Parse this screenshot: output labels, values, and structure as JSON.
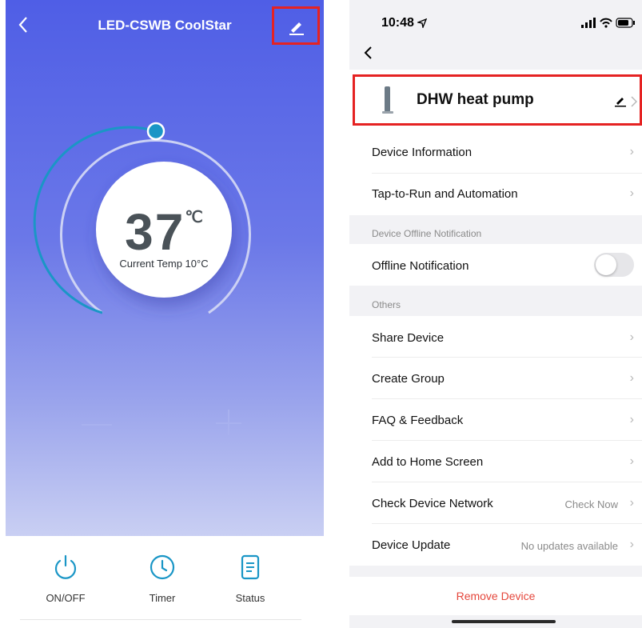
{
  "left_app": {
    "title": "LED-CSWB CoolStar",
    "set_temp": "37",
    "unit": "℃",
    "current_temp": "Current Temp 10°C",
    "toolbar": [
      {
        "label": "ON/OFF",
        "icon": "power-icon"
      },
      {
        "label": "Timer",
        "icon": "clock-icon"
      },
      {
        "label": "Status",
        "icon": "document-icon"
      }
    ],
    "accent_color": "#1a96c6",
    "highlight_color": "#e52222"
  },
  "right_app": {
    "status_time": "10:48",
    "device_name": "DHW heat pump",
    "rows": {
      "device_info": "Device Information",
      "tap_to_run": "Tap-to-Run and Automation",
      "offline_section": "Device Offline Notification",
      "offline_notification": "Offline Notification",
      "offline_notification_enabled": false,
      "others_section": "Others",
      "share_device": "Share Device",
      "create_group": "Create Group",
      "faq": "FAQ & Feedback",
      "add_home": "Add to Home Screen",
      "check_network": "Check Device Network",
      "check_network_value": "Check Now",
      "device_update": "Device Update",
      "device_update_value": "No updates available"
    },
    "remove_label": "Remove Device",
    "remove_color": "#e5473c"
  }
}
